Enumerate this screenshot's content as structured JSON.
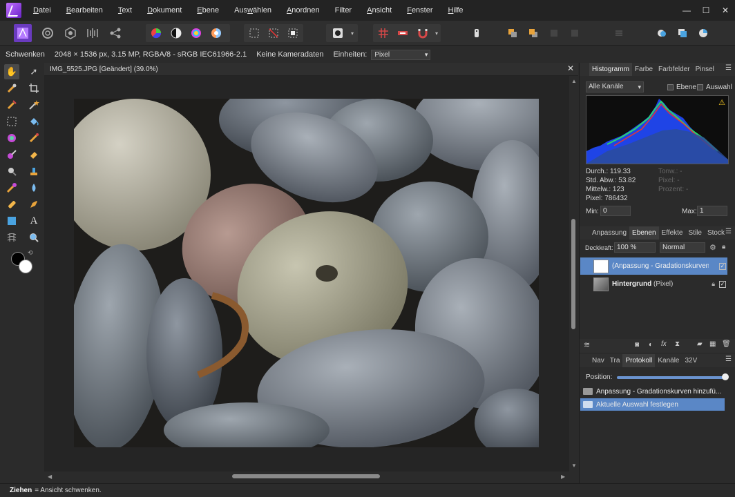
{
  "menubar": {
    "items": [
      {
        "label": "Datei",
        "u": "D",
        "rest": "atei"
      },
      {
        "label": "Bearbeiten",
        "u": "B",
        "rest": "earbeiten"
      },
      {
        "label": "Text",
        "u": "T",
        "rest": "ext"
      },
      {
        "label": "Dokument",
        "u": "D",
        "rest": "okument"
      },
      {
        "label": "Ebene",
        "u": "E",
        "rest": "bene"
      },
      {
        "label": "Auswählen",
        "u": "w",
        "pre": "Aus",
        "rest": "ählen"
      },
      {
        "label": "Anordnen",
        "u": "A",
        "rest": "nordnen"
      },
      {
        "label": "Filter",
        "u": "",
        "rest": "Filter"
      },
      {
        "label": "Ansicht",
        "u": "A",
        "rest": "nsicht"
      },
      {
        "label": "Fenster",
        "u": "F",
        "rest": "enster"
      },
      {
        "label": "Hilfe",
        "u": "H",
        "rest": "ilfe"
      }
    ],
    "minimize": "—",
    "maximize": "☐",
    "close": "✕"
  },
  "contextbar": {
    "tool_name": "Schwenken",
    "image_info": "2048 × 1536 px, 3.15 MP, RGBA/8 - sRGB IEC61966-2.1",
    "camera": "Keine Kameradaten",
    "units_label": "Einheiten:",
    "units_value": "Pixel"
  },
  "document": {
    "tab_title": "IMG_5525.JPG [Geändert] (39.0%)",
    "close": "✕"
  },
  "histogram_panel": {
    "tabs": [
      "Histogramm",
      "Farbe",
      "Farbfelder",
      "Pinsel"
    ],
    "channel": "Alle Kanäle",
    "layer_label": "Ebene",
    "selection_label": "Auswahl",
    "warning": "⚠",
    "stats": {
      "mean": "Durch.: 119.33",
      "std": "Std. Abw.: 53.82",
      "median": "Mittelw.: 123",
      "pixels": "Pixel: 786432",
      "tone": "Tonw.: -",
      "pixel_dim": "Pixel: -",
      "percent": "Prozent: -"
    },
    "min_label": "Min:",
    "min_value": "0",
    "max_label": "Max:",
    "max_value": "1"
  },
  "layers_panel": {
    "tabs": [
      "Anpassung",
      "Ebenen",
      "Effekte",
      "Stile",
      "Stock"
    ],
    "opacity_label": "Deckkraft:",
    "opacity_value": "100 %",
    "blend_mode": "Normal",
    "layers": [
      {
        "name": "(Anpassung - Gradationskurven)",
        "selected": true
      },
      {
        "name_bold": "Hintergrund",
        "name_rest": " (Pixel)",
        "selected": false
      }
    ]
  },
  "history_panel": {
    "tabs": [
      "Nav",
      "Tra",
      "Protokoll",
      "Kanäle",
      "32V"
    ],
    "position_label": "Position:",
    "entries": [
      "Anpassung - Gradationskurven hinzufü...",
      "Aktuelle Auswahl festlegen"
    ]
  },
  "statusbar": {
    "action": "Ziehen",
    "description": "= Ansicht schwenken."
  },
  "colors": {
    "accent": "#5a87c6",
    "panel": "#2b2b2b",
    "menubar": "#232323"
  }
}
